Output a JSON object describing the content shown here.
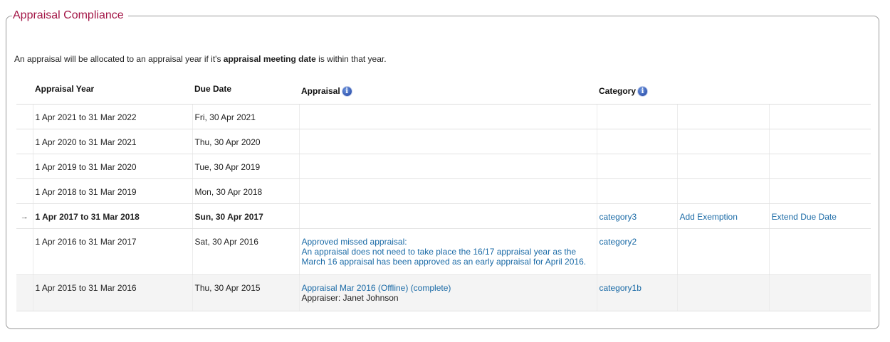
{
  "section": {
    "title": "Appraisal Compliance",
    "intro_prefix": "An appraisal will be allocated to an appraisal year if it's ",
    "intro_bold": "appraisal meeting date",
    "intro_suffix": " is within that year."
  },
  "columns": {
    "appraisal_year": "Appraisal Year",
    "due_date": "Due Date",
    "appraisal": "Appraisal",
    "category": "Category",
    "info_icon": "info-icon"
  },
  "current_marker": "→",
  "rows": [
    {
      "year": "1 Apr 2021 to 31 Mar 2022",
      "due": "Fri, 30 Apr 2021"
    },
    {
      "year": "1 Apr 2020 to 31 Mar 2021",
      "due": "Thu, 30 Apr 2020"
    },
    {
      "year": "1 Apr 2019 to 31 Mar 2020",
      "due": "Tue, 30 Apr 2019"
    },
    {
      "year": "1 Apr 2018 to 31 Mar 2019",
      "due": "Mon, 30 Apr 2018"
    },
    {
      "year": "1 Apr 2017 to 31 Mar 2018",
      "due": "Sun, 30 Apr 2017",
      "category": "category3",
      "action1": "Add Exemption",
      "action2": "Extend Due Date"
    },
    {
      "year": "1 Apr 2016 to 31 Mar 2017",
      "due": "Sat, 30 Apr 2016",
      "appraisal_line1": "Approved missed appraisal:",
      "appraisal_line2": "An appraisal does not need to take place the 16/17 appraisal year as the",
      "appraisal_line3": "March 16 appraisal has been approved as an early appraisal for April 2016.",
      "category": "category2"
    },
    {
      "year": "1 Apr 2015 to 31 Mar 2016",
      "due": "Thu, 30 Apr 2015",
      "appraisal_link": "Appraisal Mar 2016 (Offline) (complete)",
      "appraiser": "Appraiser: Janet Johnson",
      "category": "category1b"
    }
  ],
  "colors": {
    "title": "#a31646",
    "link": "#1a6aa6",
    "info_icon": "#2a4fb0"
  }
}
